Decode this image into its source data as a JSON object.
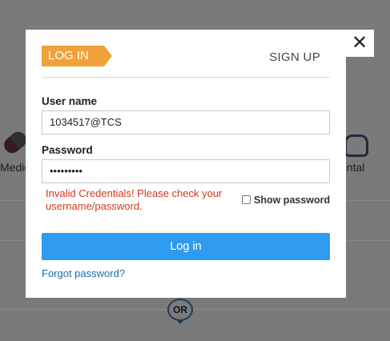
{
  "background": {
    "left_label": "Medici",
    "right_label": "ental",
    "or_label": "OR"
  },
  "modal": {
    "close_glyph": "✕",
    "tabs": {
      "login": "LOG IN",
      "signup": "SIGN UP"
    },
    "username": {
      "label": "User name",
      "value": "1034517@TCS"
    },
    "password": {
      "label": "Password",
      "value": "•••••••••"
    },
    "error": "Invalid Credentials! Please check your username/password.",
    "show_password_label": "Show password",
    "login_button": "Log in",
    "forgot_link": "Forgot password?"
  },
  "colors": {
    "accent_orange": "#f1a13a",
    "primary_blue": "#2f9bf0",
    "error_red": "#d0381f",
    "link_blue": "#1e6ca8"
  }
}
